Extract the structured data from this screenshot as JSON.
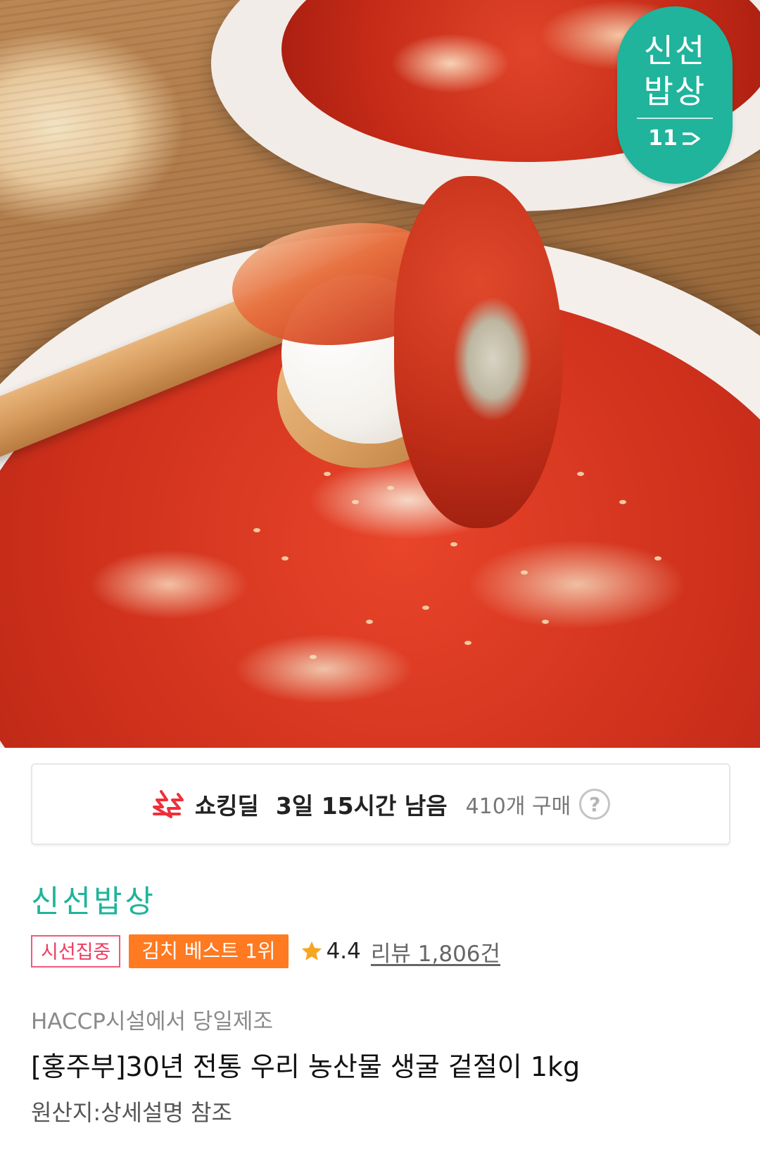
{
  "badge": {
    "line1": "신선",
    "line2": "밥상",
    "logo_text": "11"
  },
  "hero": {
    "image_alt": "kimchi with oysters on a wooden spoon"
  },
  "deal": {
    "icon": "lightning-bolt-icon",
    "label": "쇼킹딜",
    "remaining": "3일 15시간 남음",
    "purchases": "410개 구매",
    "help_icon": "question-circle-icon",
    "help_symbol": "?"
  },
  "product": {
    "store_name": "신선밥상",
    "tags": {
      "focus": "시선집중",
      "best": "김치 베스트 1위"
    },
    "rating": "4.4",
    "reviews": "리뷰 1,806건",
    "subtitle": "HACCP시설에서 당일제조",
    "title": "[홍주부]30년 전통 우리 농산물 생굴 겉절이 1kg",
    "origin": "원산지:상세설명 참조"
  },
  "colors": {
    "brand_green": "#1fb49b",
    "accent_orange": "#ff7a21",
    "accent_pink": "#ef3e5f",
    "star": "#f5a623"
  }
}
